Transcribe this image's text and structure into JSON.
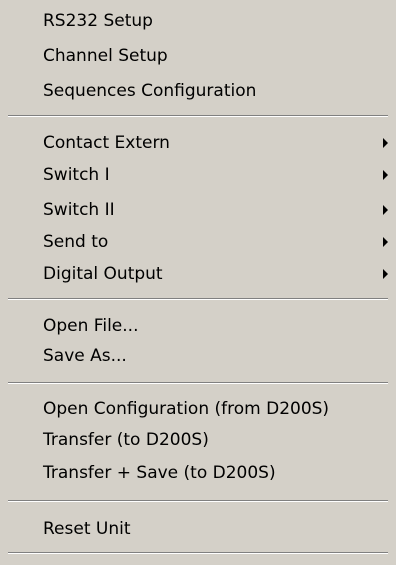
{
  "menu": {
    "group1": [
      {
        "label": "RS232 Setup"
      },
      {
        "label": "Channel Setup"
      },
      {
        "label": "Sequences Configuration"
      }
    ],
    "group2": [
      {
        "label": "Contact Extern",
        "submenu": true
      },
      {
        "label": "Switch I",
        "submenu": true
      },
      {
        "label": "Switch II",
        "submenu": true
      },
      {
        "label": "Send to",
        "submenu": true
      },
      {
        "label": "Digital Output",
        "submenu": true
      }
    ],
    "group3": [
      {
        "label": "Open File..."
      },
      {
        "label": "Save As..."
      }
    ],
    "group4": [
      {
        "label": "Open Configuration (from D200S)"
      },
      {
        "label": "Transfer (to D200S)"
      },
      {
        "label": "Transfer + Save (to D200S)"
      }
    ],
    "group5": [
      {
        "label": "Reset Unit"
      }
    ]
  },
  "colors": {
    "background": "#d4d0c8",
    "text": "#000000",
    "separator_shadow": "#808080",
    "separator_highlight": "#ffffff"
  },
  "icons": {
    "submenu": "submenu-arrow-icon"
  }
}
